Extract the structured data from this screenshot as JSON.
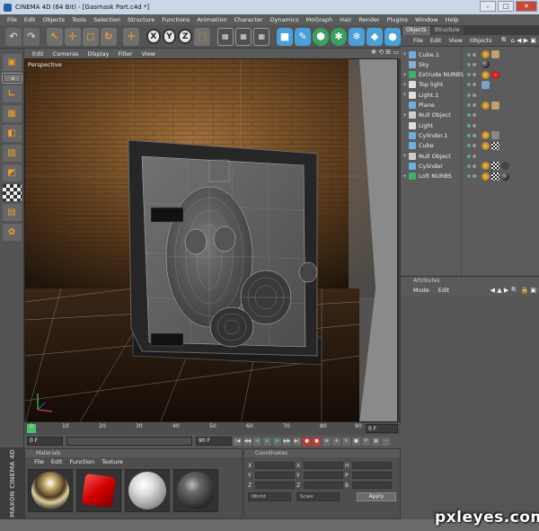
{
  "window": {
    "title": "CINEMA 4D (64 Bit) - [Gasmask Part.c4d *]",
    "minimize": "–",
    "maximize": "□",
    "close": "✕"
  },
  "menubar": [
    "File",
    "Edit",
    "Objects",
    "Tools",
    "Selection",
    "Structure",
    "Functions",
    "Animation",
    "Character",
    "Dynamics",
    "MoGraph",
    "Hair",
    "Render",
    "Plugins",
    "Window",
    "Help"
  ],
  "toolbar": {
    "undo": "↶",
    "redo": "↷",
    "live_select": "↖",
    "move": "✛",
    "scale": "◻",
    "rotate": "↻",
    "world": "✛",
    "x": "X",
    "y": "Y",
    "z": "Z",
    "coord": "⬚",
    "render_view": "▦",
    "render_picture": "▦",
    "render_settings": "▦",
    "cube": "■",
    "spline": "✎",
    "nurbs": "⬢",
    "array": "✱",
    "effector": "❄",
    "deformer": "◆",
    "light": "●"
  },
  "left_tools": [
    "▣",
    "▲",
    "∟",
    "▦",
    "◧",
    "▧",
    "◩",
    "",
    "▤",
    "✿"
  ],
  "viewport": {
    "menu": [
      "Edit",
      "Cameras",
      "Display",
      "Filter",
      "View"
    ],
    "label": "Perspective",
    "nav_icons": "✥ ⟲ ⊞ ▭"
  },
  "timeline": {
    "ticks": [
      "0",
      "10",
      "20",
      "30",
      "40",
      "50",
      "60",
      "70",
      "80",
      "90"
    ],
    "current_frame": "0 F"
  },
  "transport": {
    "start_frame": "0 F",
    "end_frame": "90 F",
    "buttons": [
      "|◀",
      "◀◀",
      "◀|",
      "▶",
      "|▶",
      "▶▶",
      "▶|",
      "●",
      "●",
      "⊕",
      "✛",
      "↻",
      "■",
      "P",
      "▦",
      "⋯"
    ]
  },
  "branding": "MAXON CINEMA 4D",
  "materials": {
    "header": "Materials",
    "menu": [
      "File",
      "Edit",
      "Function",
      "Texture"
    ]
  },
  "coordinates": {
    "header": "Coordinates",
    "rows": [
      {
        "axis1": "X",
        "axis2": "X",
        "axis3": "H"
      },
      {
        "axis1": "Y",
        "axis2": "Y",
        "axis3": "P"
      },
      {
        "axis1": "Z",
        "axis2": "Z",
        "axis3": "B"
      }
    ],
    "mode1": "World",
    "mode2": "Scale",
    "apply": "Apply"
  },
  "object_manager": {
    "tabs": [
      "Objects",
      "Structure"
    ],
    "menu": [
      "File",
      "Edit",
      "View",
      "Objects"
    ],
    "header_icons": "🔍 ⌂ ◀ ▶ ▣",
    "objects": [
      {
        "name": "Cube.1",
        "expand": "+",
        "icon_color": "#6ab0e0",
        "tags": [
          "ph",
          "tex"
        ]
      },
      {
        "name": "Sky",
        "expand": "",
        "icon_color": "#8ab0d0",
        "tags": [
          "blk"
        ]
      },
      {
        "name": "Extrude NURBS",
        "expand": "+",
        "icon_color": "#40b070",
        "tags": [
          "ph",
          "red"
        ]
      },
      {
        "name": "Top light",
        "expand": "+",
        "icon_color": "#e0e0e0",
        "tags": [
          "blue"
        ]
      },
      {
        "name": "Light.1",
        "expand": "+",
        "icon_color": "#e0e0e0",
        "tags": []
      },
      {
        "name": "Plane",
        "expand": "",
        "icon_color": "#6ab0e0",
        "tags": [
          "ph",
          "tex"
        ]
      },
      {
        "name": "Null Object",
        "expand": "+",
        "icon_color": "#cccccc",
        "tags": []
      },
      {
        "name": "Light",
        "expand": "",
        "icon_color": "#e0e0e0",
        "tags": []
      },
      {
        "name": "Cylinder.1",
        "expand": "",
        "icon_color": "#6ab0e0",
        "tags": [
          "ph",
          "grey"
        ]
      },
      {
        "name": "Cube",
        "expand": "",
        "icon_color": "#6ab0e0",
        "tags": [
          "ph",
          "chk"
        ]
      },
      {
        "name": "Null Object",
        "expand": "+",
        "icon_color": "#cccccc",
        "tags": []
      },
      {
        "name": "Cylinder",
        "expand": "",
        "icon_color": "#6ab0e0",
        "tags": [
          "ph",
          "chk",
          "cmp"
        ]
      },
      {
        "name": "Loft NURBS",
        "expand": "+",
        "icon_color": "#40b070",
        "tags": [
          "ph",
          "chk",
          "blk"
        ]
      }
    ]
  },
  "attributes": {
    "header": "Attributes",
    "menu": [
      "Mode",
      "Edit"
    ],
    "icons": "◀ ▲ ▶ 🔍 🔒 ▣"
  },
  "watermark": "pxleyes.com"
}
